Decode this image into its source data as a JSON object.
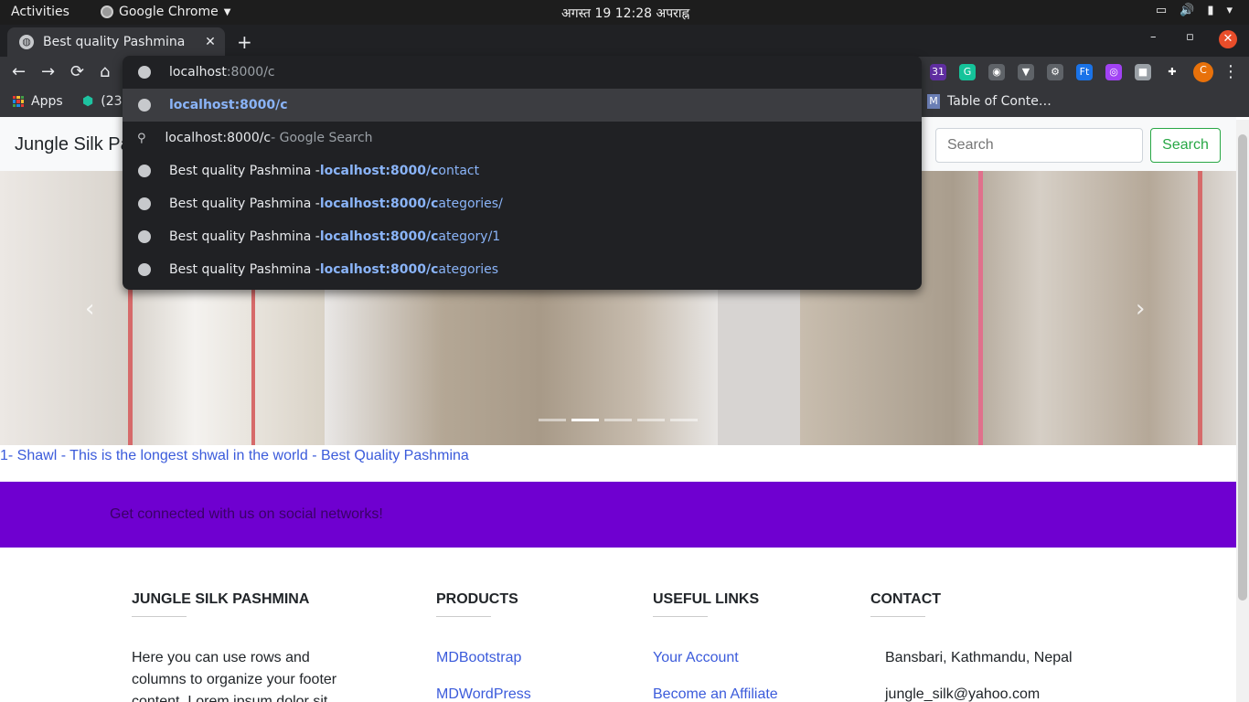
{
  "system_bar": {
    "activities": "Activities",
    "app_name": "Google Chrome",
    "clock": "अगस्त 19  12:28 अपराह्न"
  },
  "tab": {
    "title": "Best quality Pashmina",
    "close": "✕",
    "new_tab": "+"
  },
  "window_controls": {
    "minimize": "–",
    "maximize": "▫",
    "close": "✕"
  },
  "toolbar": {
    "back": "←",
    "forward": "→",
    "reload": "⟳",
    "home": "⌂",
    "menu": "⋮",
    "extensions": [
      {
        "name": "calendar-extension-icon",
        "text": "31",
        "color": "#5f2ea0"
      },
      {
        "name": "grammarly-icon",
        "text": "G",
        "color": "#15c39a"
      },
      {
        "name": "bulb-extension-icon",
        "text": "◉",
        "color": "#5f6368"
      },
      {
        "name": "vue-devtools-icon",
        "text": "▼",
        "color": "#5f6368"
      },
      {
        "name": "gear-extension-icon",
        "text": "⚙",
        "color": "#5f6368"
      },
      {
        "name": "ft-extension-icon",
        "text": "Ft",
        "color": "#1a73e8"
      },
      {
        "name": "world-extension-icon",
        "text": "◎",
        "color": "#a142f4"
      },
      {
        "name": "cube-extension-icon",
        "text": "■",
        "color": "#9aa0a6"
      },
      {
        "name": "puzzle-extensions-icon",
        "text": "✚",
        "color": "#35363a"
      },
      {
        "name": "profile-avatar-icon",
        "text": "C",
        "color": "#e8710a"
      }
    ]
  },
  "bookmarks": {
    "apps": "Apps",
    "item2": "(23",
    "item3": "Table of Conte…",
    "item3_icon": "M"
  },
  "omnibox": {
    "typed": "localhost",
    "typed_suffix": ":8000/c",
    "suggestions": [
      {
        "kind": "url",
        "prefix": "",
        "bold_url": "localhost:8000/c",
        "url_rest": "",
        "selected": true
      },
      {
        "kind": "search",
        "prefix": "localhost:8000/c",
        "suffix": " - Google Search"
      },
      {
        "kind": "history",
        "prefix": "Best quality Pashmina - ",
        "bold_url": "localhost:8000/c",
        "url_rest": "ontact"
      },
      {
        "kind": "history",
        "prefix": "Best quality Pashmina - ",
        "bold_url": "localhost:8000/c",
        "url_rest": "ategories/"
      },
      {
        "kind": "history",
        "prefix": "Best quality Pashmina - ",
        "bold_url": "localhost:8000/c",
        "url_rest": "ategory/1"
      },
      {
        "kind": "history",
        "prefix": "Best quality Pashmina - ",
        "bold_url": "localhost:8000/c",
        "url_rest": "ategories"
      }
    ]
  },
  "site": {
    "brand": "Jungle Silk Pa",
    "search_placeholder": "Search",
    "search_button": "Search",
    "carousel": {
      "prev": "‹",
      "next": "›",
      "slide_count": 5,
      "active_index": 1
    },
    "caption": "1- Shawl - This is the longest shwal in the world - Best Quality Pashmina",
    "social_text": "Get connected with us on social networks!",
    "footer": {
      "col1": {
        "title": "JUNGLE SILK PASHMINA",
        "body": "Here you can use rows and columns to organize your footer content. Lorem ipsum dolor sit amet"
      },
      "col2": {
        "title": "PRODUCTS",
        "links": [
          "MDBootstrap",
          "MDWordPress"
        ]
      },
      "col3": {
        "title": "USEFUL LINKS",
        "links": [
          "Your Account",
          "Become an Affiliate"
        ]
      },
      "col4": {
        "title": "CONTACT",
        "lines": [
          "Bansbari, Kathmandu, Nepal",
          "jungle_silk@yahoo.com"
        ]
      }
    }
  }
}
